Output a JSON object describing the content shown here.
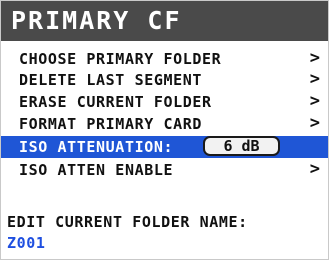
{
  "screen": {
    "title": "PRIMARY CF"
  },
  "menu": {
    "items": [
      {
        "label": "CHOOSE PRIMARY FOLDER",
        "chevron": ">"
      },
      {
        "label": "DELETE LAST SEGMENT",
        "chevron": ">"
      },
      {
        "label": "ERASE CURRENT FOLDER",
        "chevron": ">"
      },
      {
        "label": "FORMAT PRIMARY CARD",
        "chevron": ">"
      },
      {
        "label": "ISO ATTENUATION:",
        "value": "6 dB",
        "selected": true
      },
      {
        "label": "ISO ATTEN ENABLE",
        "chevron": ">"
      }
    ]
  },
  "folder_name": {
    "label": "EDIT CURRENT FOLDER NAME:",
    "value": "Z001"
  },
  "colors": {
    "title_bar": "#4a4a4a",
    "selection": "#1f56d6",
    "folder_value": "#1f4fe0"
  }
}
